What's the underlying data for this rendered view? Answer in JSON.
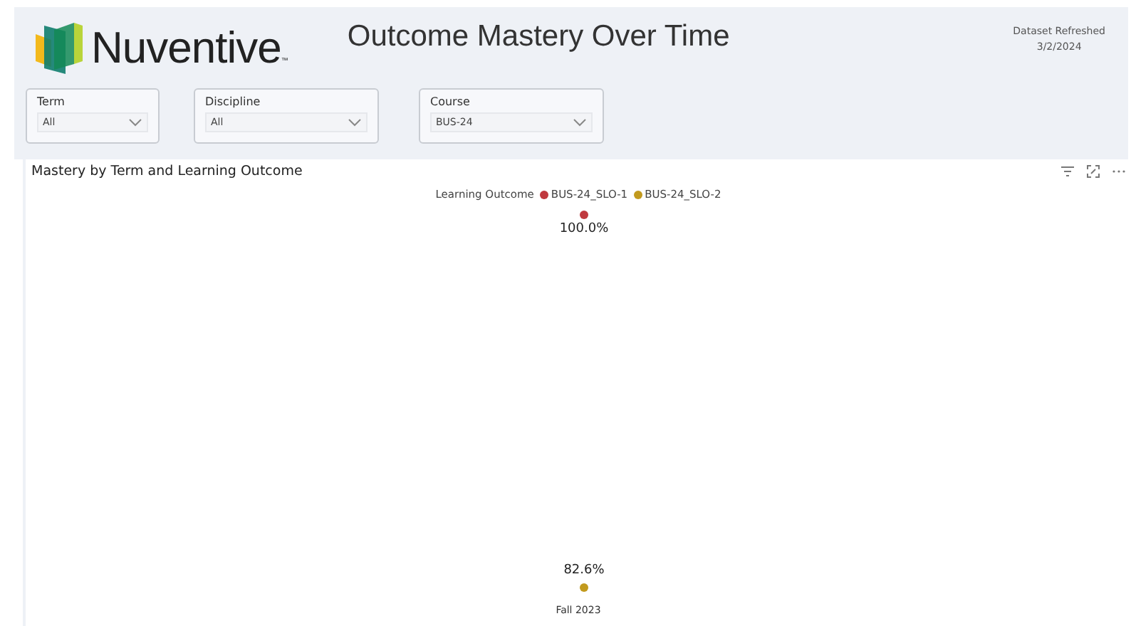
{
  "header": {
    "logo_text": "Nuventive",
    "logo_mark": "™",
    "title": "Outcome Mastery Over Time",
    "refresh_label": "Dataset Refreshed",
    "refresh_date": "3/2/2024"
  },
  "filters": [
    {
      "label": "Term",
      "value": "All"
    },
    {
      "label": "Discipline",
      "value": "All"
    },
    {
      "label": "Course",
      "value": "BUS-24"
    }
  ],
  "chart_panel": {
    "title": "Mastery by Term and Learning Outcome",
    "legend_title": "Learning Outcome",
    "legend": [
      {
        "name": "BUS-24_SLO-1",
        "color": "#c0393e"
      },
      {
        "name": "BUS-24_SLO-2",
        "color": "#c29a1e"
      }
    ],
    "points": [
      {
        "label": "100.0%",
        "color": "#c0393e"
      },
      {
        "label": "82.6%",
        "color": "#c29a1e"
      }
    ],
    "x_label": "Fall 2023"
  }
}
